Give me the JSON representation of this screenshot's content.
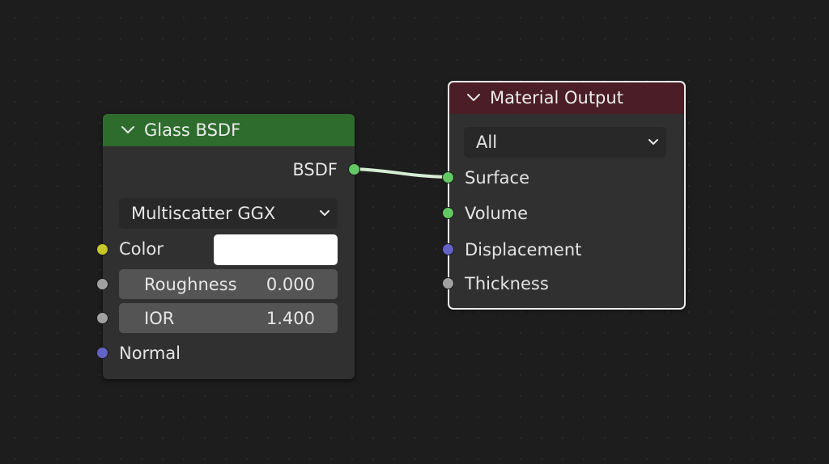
{
  "glass_node": {
    "title": "Glass BSDF",
    "header_color": "#2e6c2d",
    "output_socket": "BSDF",
    "distribution": "Multiscatter GGX",
    "inputs": {
      "color": {
        "label": "Color",
        "value_color": "#ffffff"
      },
      "roughness": {
        "label": "Roughness",
        "value": "0.000"
      },
      "ior": {
        "label": "IOR",
        "value": "1.400"
      },
      "normal": {
        "label": "Normal"
      }
    }
  },
  "output_node": {
    "title": "Material Output",
    "header_color": "#4b1d26",
    "target": "All",
    "inputs": {
      "surface": "Surface",
      "volume": "Volume",
      "displacement": "Displacement",
      "thickness": "Thickness"
    }
  },
  "socket_colors": {
    "shader": "#63c763",
    "color": "#c7c729",
    "float": "#a1a1a1",
    "vector": "#6363c7"
  },
  "link_color": "#d6ecd4"
}
